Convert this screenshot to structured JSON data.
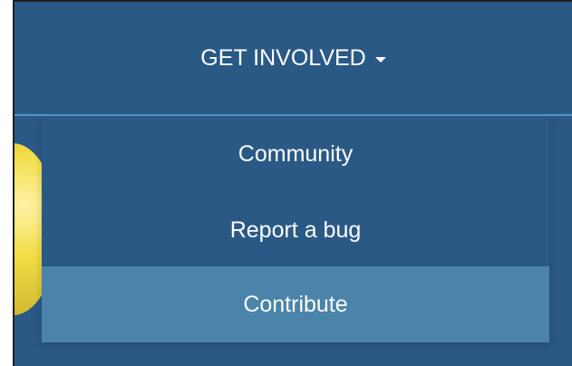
{
  "nav": {
    "toggle_label": "GET INVOLVED",
    "toggle_icon": "caret-down-icon"
  },
  "menu": {
    "items": [
      {
        "label": "Community"
      },
      {
        "label": "Report a bug"
      },
      {
        "label": "Contribute",
        "active": true
      }
    ]
  },
  "colors": {
    "nav_background": "#2a5985",
    "active_item": "#4b84aa",
    "text": "#ffffff",
    "border_accent": "#4f98c9"
  }
}
